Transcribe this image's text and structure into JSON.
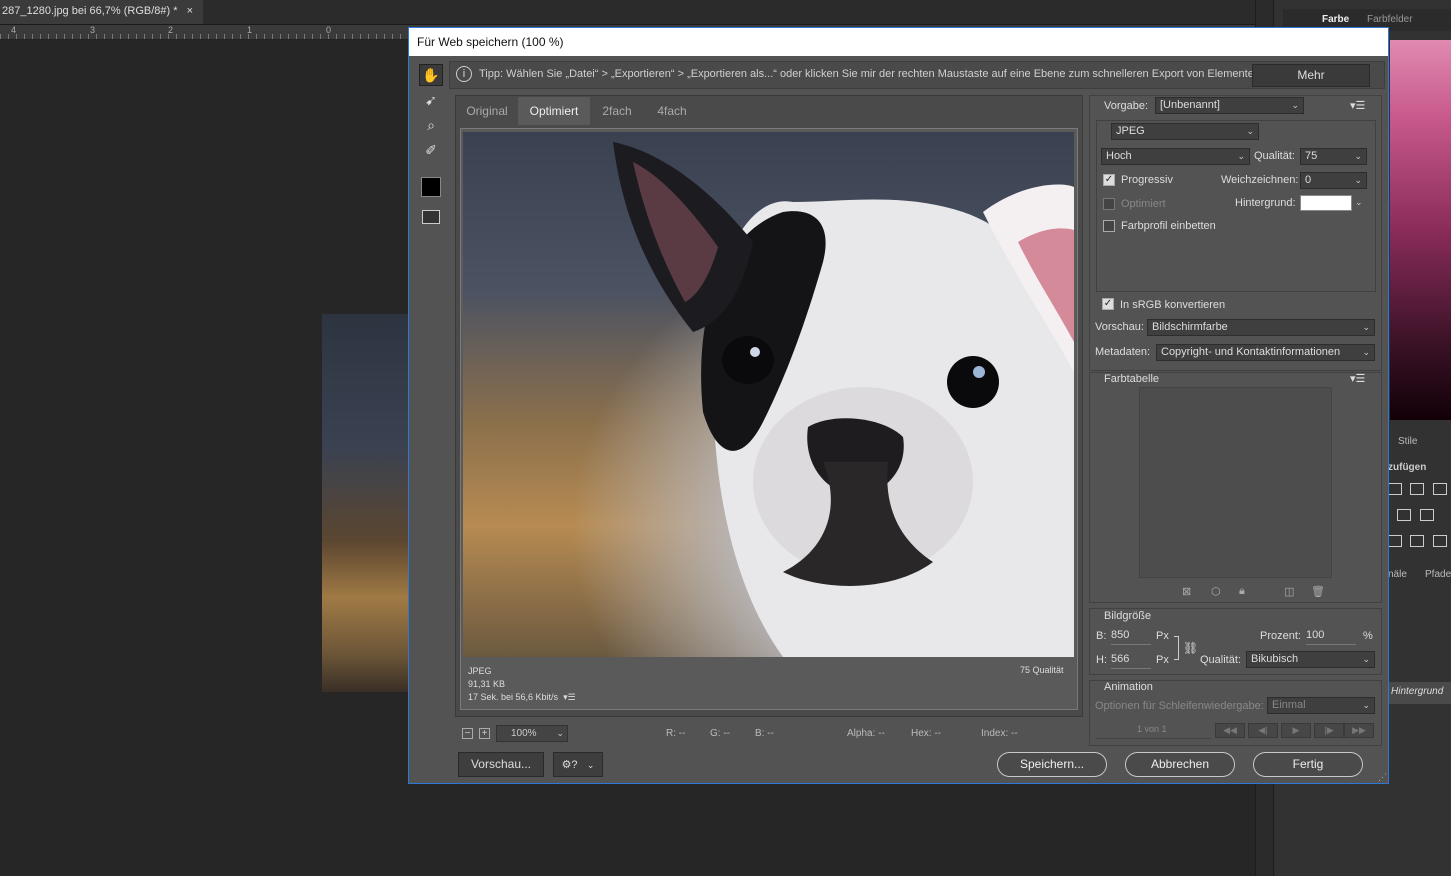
{
  "app": {
    "doc_tab": "287_1280.jpg bei 66,7% (RGB/8#) *",
    "doc_tab_close": "×",
    "ruler_numbers": [
      "4",
      "3",
      "2",
      "1",
      "0"
    ],
    "panel_tabs": [
      "Farbe",
      "Farbfelder"
    ],
    "stile_tab": "Stile",
    "zufuegen_label": "zufügen",
    "kanaele_tab": "näle",
    "pfade_tab": "Pfade",
    "layer_name": "Hintergrund"
  },
  "dialog": {
    "title": "Für Web speichern (100 %)",
    "tip": "Tipp: Wählen Sie „Datei“ > „Exportieren“ > „Exportieren als...“ oder klicken Sie mir der rechten Maustaste auf eine Ebene zum schnelleren Export von Elementen",
    "tip_icon": "i",
    "mehr_button": "Mehr",
    "tools": [
      "hand-tool",
      "slice-select-tool",
      "zoom-tool",
      "eyedropper-tool",
      "eyedropper-color",
      "toggle-slices-visibility"
    ],
    "preview_tabs": [
      "Original",
      "Optimiert",
      "2fach",
      "4fach"
    ],
    "active_tab": "Optimiert",
    "image_info": {
      "format": "JPEG",
      "size": "91,31 KB",
      "time": "17 Sek. bei 56,6 Kbit/s",
      "quality": "75 Qualität"
    },
    "statusbar": {
      "zoom": "100%",
      "r": "R: --",
      "g": "G: --",
      "b": "B: --",
      "alpha": "Alpha: --",
      "hex": "Hex: --",
      "index": "Index: --"
    },
    "buttons": {
      "vorschau": "Vorschau...",
      "speichern": "Speichern...",
      "abbrechen": "Abbrechen",
      "fertig": "Fertig"
    },
    "settings": {
      "vorgabe_label": "Vorgabe:",
      "vorgabe_value": "[Unbenannt]",
      "format": "JPEG",
      "compression": "Hoch",
      "qualitaet_label": "Qualität:",
      "qualitaet_value": "75",
      "progressiv_label": "Progressiv",
      "progressiv_checked": true,
      "weichzeichnen_label": "Weichzeichnen:",
      "weichzeichnen_value": "0",
      "optimiert_label": "Optimiert",
      "hintergrund_label": "Hintergrund:",
      "hintergrund_color": "#ffffff",
      "farbprofil_label": "Farbprofil einbetten",
      "srgb_label": "In sRGB konvertieren",
      "srgb_checked": true,
      "vorschau_label": "Vorschau:",
      "vorschau_value": "Bildschirmfarbe",
      "metadaten_label": "Metadaten:",
      "metadaten_value": "Copyright- und Kontaktinformationen",
      "farbtabelle_label": "Farbtabelle",
      "bildgroesse_label": "Bildgröße",
      "b_label": "B:",
      "b_value": "850",
      "h_label": "H:",
      "h_value": "566",
      "px_unit": "Px",
      "prozent_label": "Prozent:",
      "prozent_value": "100",
      "percent_unit": "%",
      "qualitaet2_label": "Qualität:",
      "qualitaet2_value": "Bikubisch",
      "animation_label": "Animation",
      "schleife_label": "Optionen für Schleifenwiedergabe:",
      "schleife_value": "Einmal",
      "frame_counter": "1 von 1"
    }
  },
  "colors": {
    "dialog_bg": "#535353",
    "accent_border": "#2b78d6",
    "panel_bg": "#4a4a4a"
  }
}
